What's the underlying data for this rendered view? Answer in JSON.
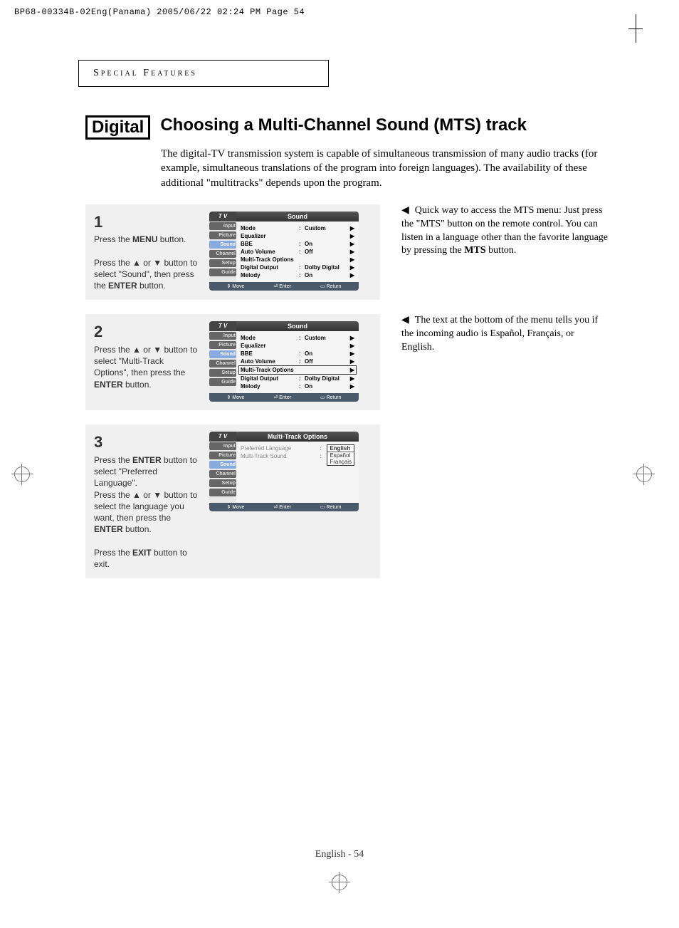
{
  "header_line": "BP68-00334B-02Eng(Panama)  2005/06/22  02:24 PM  Page 54",
  "section_header": "Special Features",
  "digital_tag": "Digital",
  "main_title": "Choosing a Multi-Channel Sound (MTS) track",
  "intro": "The digital-TV transmission system is capable of simultaneous transmission of many audio tracks (for example, simultaneous translations of the program into foreign languages). The availability of these additional \"multitracks\" depends upon the program.",
  "steps": [
    {
      "num": "1",
      "html": "Press the <b>MENU</b> button.<br><br>Press the ▲ or ▼ button to select \"Sound\", then press the <b>ENTER</b> button."
    },
    {
      "num": "2",
      "html": "Press the ▲ or ▼ button to select \"Multi-Track Options\", then press the <b>ENTER</b> button."
    },
    {
      "num": "3",
      "html": "Press the <b>ENTER</b> button to select \"Preferred Language\".<br>Press the ▲ or ▼ button to select the language you want, then press the <b>ENTER</b> button.<br><br>Press the <b>EXIT</b> button to exit."
    }
  ],
  "notes": [
    "Quick way to access the MTS menu: Just press the \"MTS\" button on the remote control. You can listen in a language other than the favorite language by pressing the <b>MTS</b> button.",
    "The text at the bottom of the menu tells you if the incoming audio is Español, Français, or English."
  ],
  "osd": {
    "tv": "T V",
    "sound_title": "Sound",
    "mto_title": "Multi-Track Options",
    "nav": [
      "Input",
      "Picture",
      "Sound",
      "Channel",
      "Setup",
      "Guide"
    ],
    "sound_rows": [
      {
        "label": "Mode",
        "colon": ":",
        "value": "Custom",
        "arrow": "▶"
      },
      {
        "label": "Equalizer",
        "colon": "",
        "value": "",
        "arrow": "▶"
      },
      {
        "label": "BBE",
        "colon": ":",
        "value": "On",
        "arrow": "▶"
      },
      {
        "label": "Auto Volume",
        "colon": ":",
        "value": "Off",
        "arrow": "▶"
      },
      {
        "label": "Multi-Track Options",
        "colon": "",
        "value": "",
        "arrow": "▶"
      },
      {
        "label": "Digital Output",
        "colon": ":",
        "value": "Dolby Digital",
        "arrow": "▶"
      },
      {
        "label": "Melody",
        "colon": ":",
        "value": "On",
        "arrow": "▶"
      }
    ],
    "mto_rows": [
      {
        "label": "Preferred Language",
        "colon": ":"
      },
      {
        "label": "Multi-Track Sound",
        "colon": ":"
      }
    ],
    "languages": [
      "English",
      "Español",
      "Français"
    ],
    "footer": {
      "move": "Move",
      "enter": "Enter",
      "return": "Return"
    }
  },
  "footer": "English - 54"
}
